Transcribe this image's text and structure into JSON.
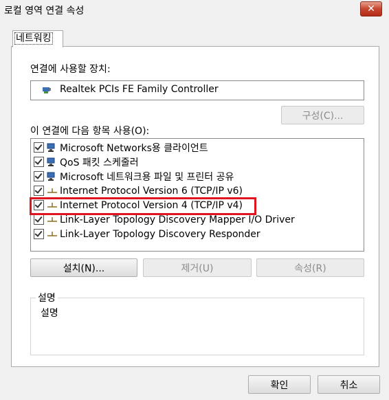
{
  "window": {
    "title": "로컬 영역 연결 속성",
    "close_label": "✕"
  },
  "tab": {
    "label": "네트워킹"
  },
  "connect_using": {
    "label": "연결에 사용할 장치:",
    "device_name": "Realtek PCIs FE Family Controller",
    "configure_label": "구성(C)..."
  },
  "items_section": {
    "label": "이 연결에 다음 항목 사용(O):",
    "items": [
      {
        "label": "Microsoft Networks용 클라이언트",
        "checked": true,
        "icon": "network-client-icon"
      },
      {
        "label": "QoS 패킷 스케줄러",
        "checked": true,
        "icon": "network-service-icon"
      },
      {
        "label": "Microsoft 네트워크용 파일 및 프린터 공유",
        "checked": true,
        "icon": "network-service-icon"
      },
      {
        "label": "Internet Protocol Version 6 (TCP/IP v6)",
        "checked": true,
        "icon": "protocol-icon"
      },
      {
        "label": "Internet Protocol Version 4 (TCP/IP v4)",
        "checked": true,
        "icon": "protocol-icon",
        "highlighted": true
      },
      {
        "label": "Link-Layer Topology Discovery Mapper I/O Driver",
        "checked": true,
        "icon": "protocol-icon"
      },
      {
        "label": "Link-Layer Topology Discovery Responder",
        "checked": true,
        "icon": "protocol-icon"
      }
    ]
  },
  "actions": {
    "install_label": "설치(N)...",
    "uninstall_label": "제거(U)",
    "properties_label": "속성(R)"
  },
  "description": {
    "legend": "설명",
    "text": "설명"
  },
  "footer": {
    "ok_label": "확인",
    "cancel_label": "취소"
  },
  "colors": {
    "highlight_border": "#e0141e",
    "close_button": "#c7452f"
  }
}
